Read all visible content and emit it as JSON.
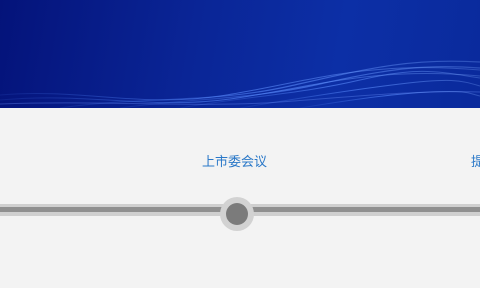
{
  "timeline": {
    "steps": [
      {
        "label": "上市委会议",
        "state": "current"
      },
      {
        "label": "提",
        "state": "next"
      }
    ]
  },
  "colors": {
    "banner": "#0a2596",
    "panel": "#f3f3f3",
    "label": "#2a78c8",
    "track": "#8f8f8f",
    "node": "#7b7b7b"
  }
}
